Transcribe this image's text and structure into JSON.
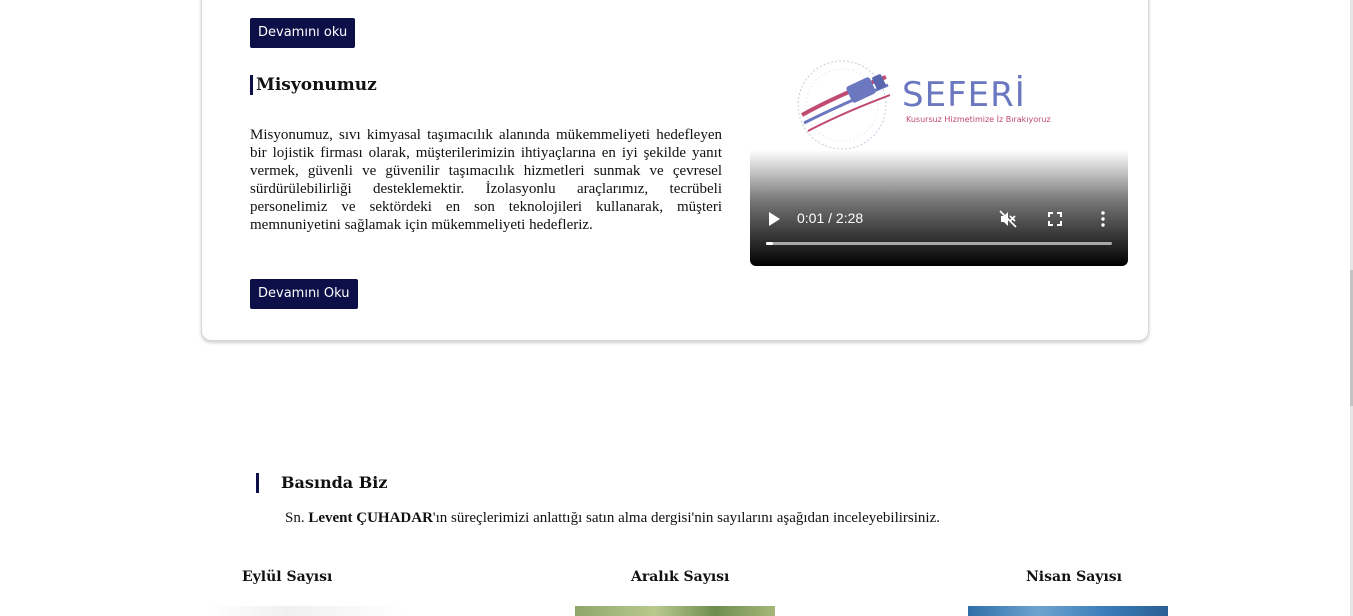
{
  "about": {
    "read_more_label": "Devamını oku"
  },
  "mission": {
    "title": "Misyonumuz",
    "text": "Misyonumuz, sıvı kimyasal taşımacılık alanında mükemmeliyeti hedefleyen bir lojistik firması olarak, müşterilerimizin ihtiyaçlarına en iyi şekilde yanıt vermek, güvenli ve güvenilir taşımacılık hizmetleri sunmak ve çevresel sürdürülebilirliği desteklemektir. İzolasyonlu araçlarımız, tecrübeli personelimiz ve sektördeki en son teknolojileri kullanarak, müşteri memnuniyetini sağlamak için mükemmeliyeti hedefleriz.",
    "read_more_label": "Devamını Oku"
  },
  "video": {
    "logo_name": "SEFERİ",
    "logo_tagline": "Kusursuz Hizmetimize İz Bırakıyoruz",
    "time_display": "0:01 / 2:28",
    "progress_fraction": 0.007,
    "icons": {
      "play": "play-icon",
      "mute": "muted-speaker-icon",
      "fullscreen": "fullscreen-icon",
      "more": "more-vertical-icon"
    },
    "colors": {
      "logo_blue": "#6b78c0",
      "logo_red": "#c04a70"
    }
  },
  "press": {
    "title": "Basında Biz",
    "subtitle_prefix": "Sn. ",
    "subtitle_name": "Levent ÇUHADAR",
    "subtitle_suffix": "'ın süreçlerimizi anlattığı satın alma dergisi'nin sayılarını aşağıdan inceleyebilirsiniz.",
    "issues": [
      {
        "label": "Eylül Sayısı"
      },
      {
        "label": "Aralık Sayısı"
      },
      {
        "label": "Nisan Sayısı"
      }
    ]
  },
  "theme": {
    "accent": "#0d0f48"
  }
}
